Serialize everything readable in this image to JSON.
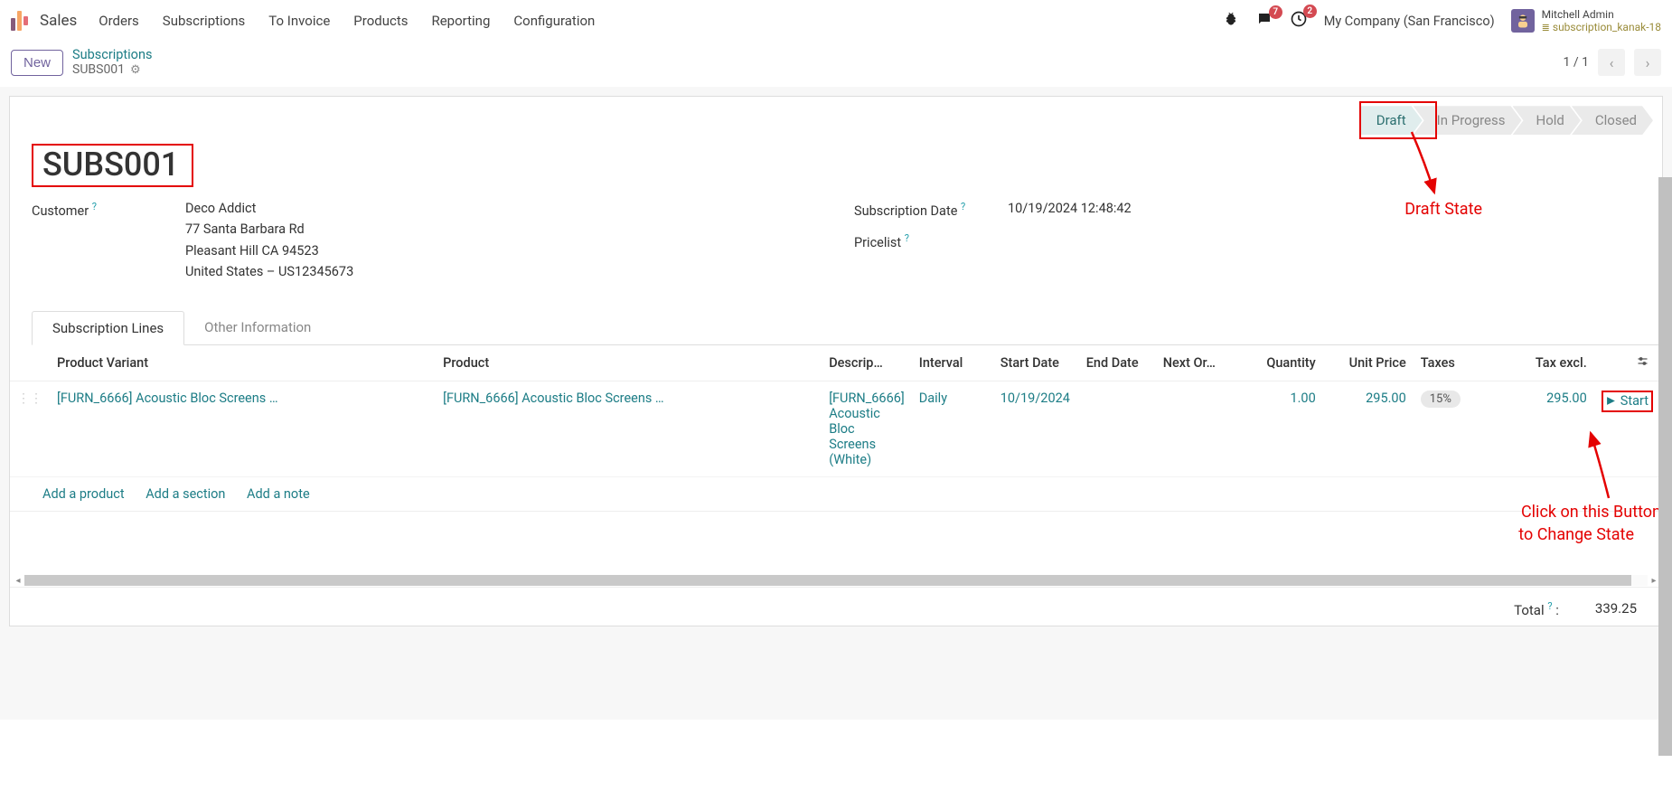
{
  "nav": {
    "app_name": "Sales",
    "links": [
      "Orders",
      "Subscriptions",
      "To Invoice",
      "Products",
      "Reporting",
      "Configuration"
    ],
    "messages_badge": "7",
    "activities_badge": "2",
    "company": "My Company (San Francisco)",
    "user_name": "Mitchell Admin",
    "db_name": "subscription_kanak-18"
  },
  "breadcrumb": {
    "new_btn": "New",
    "parent": "Subscriptions",
    "current": "SUBS001",
    "pager": "1 / 1"
  },
  "status": {
    "steps": [
      "Draft",
      "In Progress",
      "Hold",
      "Closed"
    ],
    "active_index": 0
  },
  "record": {
    "title": "SUBS001",
    "customer_label": "Customer",
    "customer_name": "Deco Addict",
    "customer_addr1": "77 Santa Barbara Rd",
    "customer_addr2": "Pleasant Hill CA 94523",
    "customer_addr3": "United States – US12345673",
    "sub_date_label": "Subscription Date",
    "sub_date_value": "10/19/2024 12:48:42",
    "pricelist_label": "Pricelist"
  },
  "tabs": [
    "Subscription Lines",
    "Other Information"
  ],
  "table": {
    "headers": {
      "variant": "Product Variant",
      "product": "Product",
      "desc": "Descrip…",
      "interval": "Interval",
      "start": "Start Date",
      "end": "End Date",
      "next": "Next Or…",
      "qty": "Quantity",
      "unit": "Unit Price",
      "taxes": "Taxes",
      "excl": "Tax excl."
    },
    "row": {
      "variant": "[FURN_6666] Acoustic Bloc Screens …",
      "product": "[FURN_6666] Acoustic Bloc Screens …",
      "desc": "[FURN_6666] Acoustic Bloc Screens (White)",
      "interval": "Daily",
      "start": "10/19/2024",
      "end": "",
      "next": "",
      "qty": "1.00",
      "unit": "295.00",
      "tax": "15%",
      "excl": "295.00",
      "start_btn": "Start"
    },
    "add_product": "Add a product",
    "add_section": "Add a section",
    "add_note": "Add a note"
  },
  "footer": {
    "total_label": "Total",
    "total_value": "339.25"
  },
  "annotations": {
    "draft_state": "Draft State",
    "click_line1": "Click on this Button",
    "click_line2": "to Change State"
  }
}
